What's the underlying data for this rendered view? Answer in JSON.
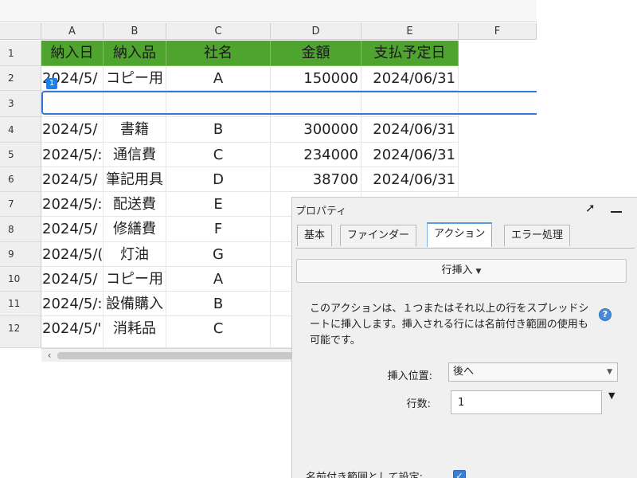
{
  "sheet": {
    "columns": [
      "A",
      "B",
      "C",
      "D",
      "E",
      "F"
    ],
    "rows": [
      "1",
      "2",
      "3",
      "4",
      "5",
      "6",
      "7",
      "8",
      "9",
      "10",
      "11",
      "12"
    ],
    "header": [
      "納入日",
      "納入品",
      "社名",
      "金額",
      "支払予定日"
    ],
    "data": [
      [
        "2024/5/",
        "コピー用",
        "A",
        "150000",
        "2024/06/31"
      ],
      [
        "",
        "",
        "",
        "",
        ""
      ],
      [
        "2024/5/",
        "書籍",
        "B",
        "300000",
        "2024/06/31"
      ],
      [
        "2024/5/:",
        "通信費",
        "C",
        "234000",
        "2024/06/31"
      ],
      [
        "2024/5/",
        "筆記用具",
        "D",
        "38700",
        "2024/06/31"
      ],
      [
        "2024/5/:",
        "配送費",
        "E",
        "",
        ""
      ],
      [
        "2024/5/",
        "修繕費",
        "F",
        "",
        ""
      ],
      [
        "2024/5/(",
        "灯油",
        "G",
        "",
        ""
      ],
      [
        "2024/5/",
        "コピー用",
        "A",
        "",
        ""
      ],
      [
        "2024/5/:",
        "設備購入",
        "B",
        "",
        ""
      ],
      [
        "2024/5/'",
        "消耗品",
        "C",
        "",
        ""
      ]
    ],
    "row_badge": "1",
    "scroll_left_icon": "chevron-left-icon"
  },
  "panel": {
    "title": "プロパティ",
    "pin_icon": "pin-icon",
    "minimize_icon": "minimize-icon",
    "tabs": [
      "基本",
      "ファインダー",
      "アクション",
      "エラー処理"
    ],
    "active_tab": "アクション",
    "action_label": "行挿入",
    "description": "このアクションは、１つまたはそれ以上の行をスプレッドシートに挿入します。挿入される行には名前付き範囲の使用も可能です。",
    "help_icon": "?",
    "position_label": "挿入位置:",
    "position_value": "後へ",
    "count_label": "行数:",
    "count_value": "1",
    "named_range_label": "名前付き範囲として設定:",
    "named_range_checked": true,
    "accent_color": "#3b7fd4",
    "header_color": "#4ea42f"
  }
}
